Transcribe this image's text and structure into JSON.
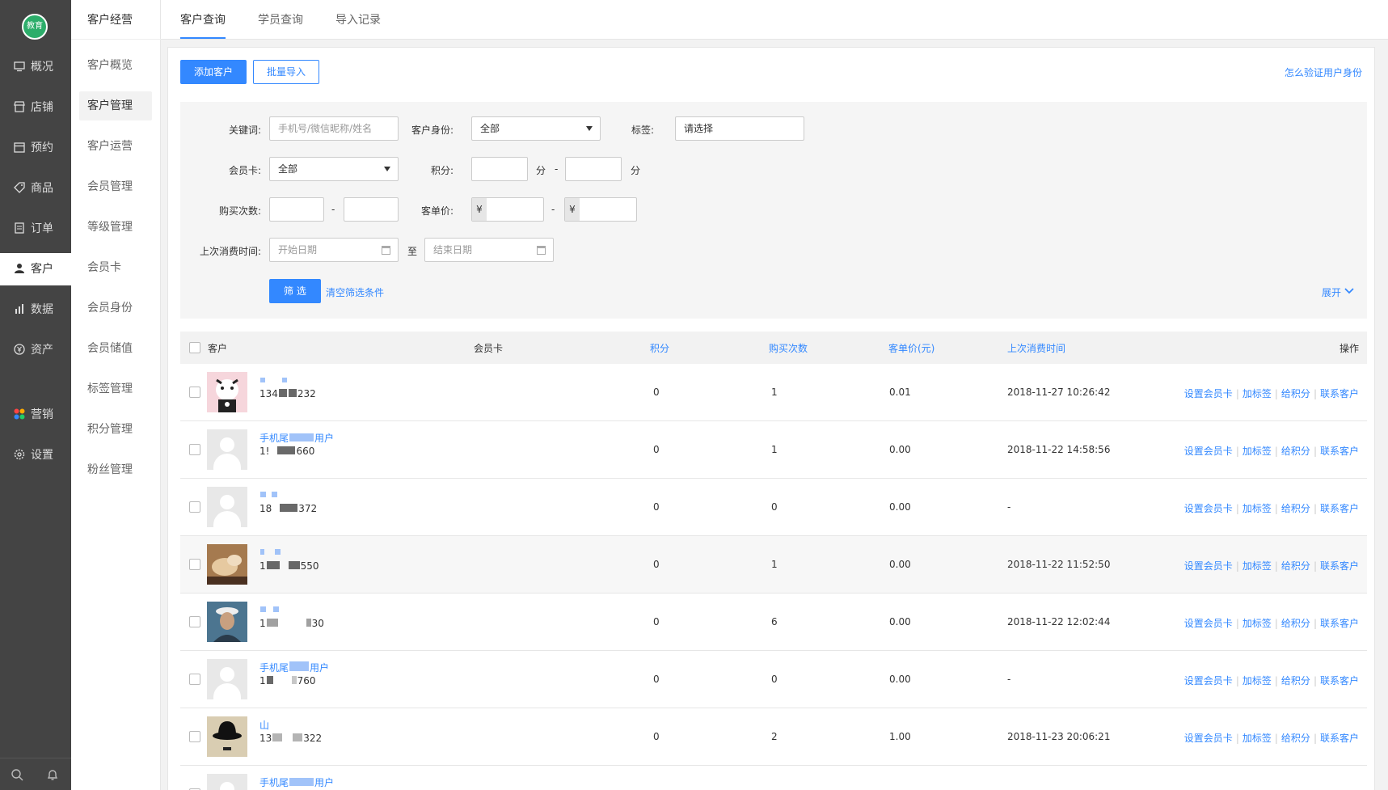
{
  "logo": {
    "text": "教育"
  },
  "primary_nav": [
    {
      "label": "概况",
      "icon": "monitor-icon"
    },
    {
      "label": "店铺",
      "icon": "store-icon"
    },
    {
      "label": "预约",
      "icon": "calendar-icon"
    },
    {
      "label": "商品",
      "icon": "tag-icon"
    },
    {
      "label": "订单",
      "icon": "document-icon"
    },
    {
      "label": "客户",
      "icon": "user-icon"
    },
    {
      "label": "数据",
      "icon": "bar-chart-icon"
    },
    {
      "label": "资产",
      "icon": "yen-icon"
    },
    {
      "label": "营销",
      "icon": "apps-icon"
    },
    {
      "label": "设置",
      "icon": "gear-icon"
    }
  ],
  "secondary_nav": {
    "title": "客户经营",
    "items": [
      "客户概览",
      "客户管理",
      "客户运营",
      "会员管理",
      "等级管理",
      "会员卡",
      "会员身份",
      "会员储值",
      "标签管理",
      "积分管理",
      "粉丝管理"
    ]
  },
  "tabs": [
    "客户查询",
    "学员查询",
    "导入记录"
  ],
  "toolbar": {
    "add": "添加客户",
    "import": "批量导入",
    "help": "怎么验证用户身份"
  },
  "filters": {
    "keyword_label": "关键词:",
    "keyword_placeholder": "手机号/微信昵称/姓名",
    "identity_label": "客户身份:",
    "identity_value": "全部",
    "tag_label": "标签:",
    "tag_value": "请选择",
    "card_label": "会员卡:",
    "card_value": "全部",
    "points_label": "积分:",
    "points_unit": "分",
    "dash": "-",
    "purchase_label": "购买次数:",
    "price_label": "客单价:",
    "yen": "¥",
    "last_time_label": "上次消费时间:",
    "start_date": "开始日期",
    "to": "至",
    "end_date": "结束日期",
    "filter_btn": "筛 选",
    "clear": "清空筛选条件",
    "expand": "展开"
  },
  "table": {
    "headers": {
      "customer": "客户",
      "card": "会员卡",
      "points": "积分",
      "purchases": "购买次数",
      "price": "客单价(元)",
      "last": "上次消费时间",
      "ops": "操作"
    },
    "actions": [
      "设置会员卡",
      "加标签",
      "给积分",
      "联系客户"
    ],
    "rows": [
      {
        "name": "",
        "phone_a": "134",
        "phone_b": "232",
        "points": "0",
        "purchases": "1",
        "price": "0.01",
        "last": "2018-11-27 10:26:42"
      },
      {
        "name": "手机尾",
        "name_b": "用户",
        "phone_a": "1!",
        "phone_b": "660",
        "points": "0",
        "purchases": "1",
        "price": "0.00",
        "last": "2018-11-22 14:58:56"
      },
      {
        "name": "",
        "phone_a": "18",
        "phone_b": "372",
        "points": "0",
        "purchases": "0",
        "price": "0.00",
        "last": "-"
      },
      {
        "name": "",
        "phone_a": "1",
        "phone_b": "550",
        "points": "0",
        "purchases": "1",
        "price": "0.00",
        "last": "2018-11-22 11:52:50"
      },
      {
        "name": "",
        "phone_a": "1",
        "phone_b": "30",
        "points": "0",
        "purchases": "6",
        "price": "0.00",
        "last": "2018-11-22 12:02:44"
      },
      {
        "name": "手机尾",
        "name_b": "用户",
        "phone_a": "1",
        "phone_b": "760",
        "points": "0",
        "purchases": "0",
        "price": "0.00",
        "last": "-"
      },
      {
        "name": "山",
        "phone_a": "13",
        "phone_b": "322",
        "points": "0",
        "purchases": "2",
        "price": "1.00",
        "last": "2018-11-23 20:06:21"
      },
      {
        "name": "手机尾",
        "name_b": "用户"
      }
    ]
  }
}
